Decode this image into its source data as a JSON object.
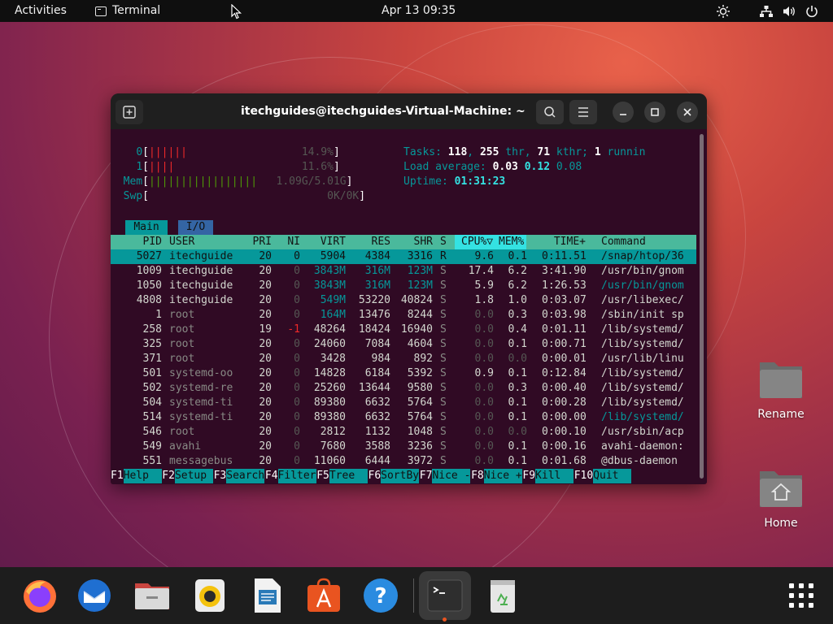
{
  "topbar": {
    "activities": "Activities",
    "app_name": "Terminal",
    "clock": "Apr 13  09:35",
    "icons": [
      "brightness-icon",
      "network-icon",
      "volume-icon",
      "power-icon"
    ]
  },
  "window": {
    "title": "itechguides@itechguides-Virtual-Machine: ~",
    "buttons": [
      "new-tab-icon",
      "search-icon",
      "menu-icon",
      "minimize-icon",
      "maximize-icon",
      "close-icon"
    ]
  },
  "htop": {
    "cpu0": {
      "label": "0",
      "bars": "||||||",
      "value": "14.9%"
    },
    "cpu1": {
      "label": "1",
      "bars": "||||",
      "value": "11.6%"
    },
    "mem": {
      "label": "Mem",
      "bars": "|||||||||||||||||",
      "value": "1.09G/5.01G"
    },
    "swp": {
      "label": "Swp",
      "value": "0K/0K"
    },
    "tasks": {
      "prefix": "Tasks: ",
      "tasks": "118",
      "sep1": ", ",
      "threads": "255",
      "thr": " thr, ",
      "kthreads": "71",
      "kthr": " kthr; ",
      "running": "1",
      "run": " runnin"
    },
    "load": {
      "prefix": "Load average: ",
      "l1": "0.03",
      "l5": "0.12",
      "l15": "0.08"
    },
    "uptime": {
      "prefix": "Uptime: ",
      "value": "01:31:23"
    },
    "tabs": {
      "main": "Main",
      "io": "I/O"
    },
    "columns": [
      "PID",
      "USER",
      "PRI",
      "NI",
      "VIRT",
      "RES",
      "SHR",
      "S",
      "CPU%▽",
      "MEM%",
      "TIME+",
      "Command"
    ],
    "processes": [
      [
        "5027",
        "itechguide",
        "20",
        "0",
        "5904",
        "4384",
        "3316",
        "R",
        "9.6",
        "0.1",
        "0:11.51",
        "/snap/htop/36"
      ],
      [
        "1009",
        "itechguide",
        "20",
        "0",
        "3843M",
        "316M",
        "123M",
        "S",
        "17.4",
        "6.2",
        "3:41.90",
        "/usr/bin/gnom"
      ],
      [
        "1050",
        "itechguide",
        "20",
        "0",
        "3843M",
        "316M",
        "123M",
        "S",
        "5.9",
        "6.2",
        "1:26.53",
        "/usr/bin/gnom"
      ],
      [
        "4808",
        "itechguide",
        "20",
        "0",
        "549M",
        "53220",
        "40824",
        "S",
        "1.8",
        "1.0",
        "0:03.07",
        "/usr/libexec/"
      ],
      [
        "1",
        "root",
        "20",
        "0",
        "164M",
        "13476",
        "8244",
        "S",
        "0.0",
        "0.3",
        "0:03.98",
        "/sbin/init sp"
      ],
      [
        "258",
        "root",
        "19",
        "-1",
        "48264",
        "18424",
        "16940",
        "S",
        "0.0",
        "0.4",
        "0:01.11",
        "/lib/systemd/"
      ],
      [
        "325",
        "root",
        "20",
        "0",
        "24060",
        "7084",
        "4604",
        "S",
        "0.0",
        "0.1",
        "0:00.71",
        "/lib/systemd/"
      ],
      [
        "371",
        "root",
        "20",
        "0",
        "3428",
        "984",
        "892",
        "S",
        "0.0",
        "0.0",
        "0:00.01",
        "/usr/lib/linu"
      ],
      [
        "501",
        "systemd-oo",
        "20",
        "0",
        "14828",
        "6184",
        "5392",
        "S",
        "0.9",
        "0.1",
        "0:12.84",
        "/lib/systemd/"
      ],
      [
        "502",
        "systemd-re",
        "20",
        "0",
        "25260",
        "13644",
        "9580",
        "S",
        "0.0",
        "0.3",
        "0:00.40",
        "/lib/systemd/"
      ],
      [
        "504",
        "systemd-ti",
        "20",
        "0",
        "89380",
        "6632",
        "5764",
        "S",
        "0.0",
        "0.1",
        "0:00.28",
        "/lib/systemd/"
      ],
      [
        "514",
        "systemd-ti",
        "20",
        "0",
        "89380",
        "6632",
        "5764",
        "S",
        "0.0",
        "0.1",
        "0:00.00",
        "/lib/systemd/"
      ],
      [
        "546",
        "root",
        "20",
        "0",
        "2812",
        "1132",
        "1048",
        "S",
        "0.0",
        "0.0",
        "0:00.10",
        "/usr/sbin/acp"
      ],
      [
        "549",
        "avahi",
        "20",
        "0",
        "7680",
        "3588",
        "3236",
        "S",
        "0.0",
        "0.1",
        "0:00.16",
        "avahi-daemon:"
      ],
      [
        "551",
        "messagebus",
        "20",
        "0",
        "11060",
        "6444",
        "3972",
        "S",
        "0.0",
        "0.1",
        "0:01.68",
        "@dbus-daemon"
      ]
    ],
    "fkeys": [
      {
        "key": "F1",
        "label": "Help  "
      },
      {
        "key": "F2",
        "label": "Setup "
      },
      {
        "key": "F3",
        "label": "Search"
      },
      {
        "key": "F4",
        "label": "Filter"
      },
      {
        "key": "F5",
        "label": "Tree  "
      },
      {
        "key": "F6",
        "label": "SortBy"
      },
      {
        "key": "F7",
        "label": "Nice -"
      },
      {
        "key": "F8",
        "label": "Nice +"
      },
      {
        "key": "F9",
        "label": "Kill  "
      },
      {
        "key": "F10",
        "label": "Quit  "
      }
    ]
  },
  "desktop": {
    "rename": "Rename",
    "home": "Home"
  },
  "dock": {
    "apps": [
      "firefox-icon",
      "thunderbird-icon",
      "files-icon",
      "rhythmbox-icon",
      "writer-icon",
      "app-center-icon",
      "help-icon",
      "terminal-icon",
      "trash-icon",
      "show-apps-icon"
    ]
  },
  "colors": {
    "topbar": "#0f0f0f",
    "terminal_bg": "#300a24",
    "selection": "#06989a",
    "header": "#4ab99c",
    "accent": "#e95420"
  }
}
